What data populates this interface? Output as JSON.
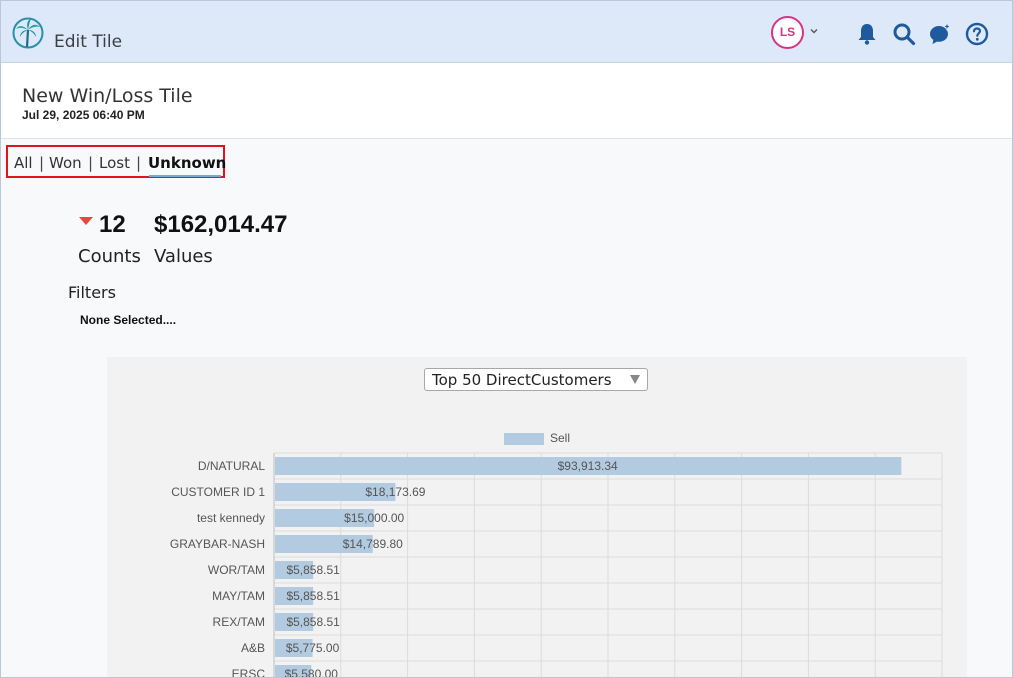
{
  "header": {
    "app_title": "Edit Tile",
    "avatar_initials": "LS",
    "icons": [
      "palm-tree-logo-icon",
      "chevron-down-icon",
      "bell-icon",
      "search-icon",
      "chat-sparkle-icon",
      "help-icon"
    ],
    "accent_color": "#d63384",
    "icon_color": "#1f5a9c"
  },
  "tile": {
    "name": "New Win/Loss Tile",
    "date": "Jul 29, 2025 06:40 PM"
  },
  "tabs": {
    "all": "All",
    "won": "Won",
    "lost": "Lost",
    "unknown": "Unknown",
    "separator": "|",
    "active": "Unknown",
    "highlight_color": "#e0141e"
  },
  "summary": {
    "count": "12",
    "count_label": "Counts",
    "value": "$162,014.47",
    "value_label": "Values",
    "trend": "down",
    "trend_color": "#e04b3c"
  },
  "filters": {
    "title": "Filters",
    "value": "None Selected...."
  },
  "chart_controls": {
    "select_value": "Top 50 DirectCustomers"
  },
  "chart_data": {
    "type": "bar",
    "orientation": "horizontal",
    "categories": [
      "D/NATURAL",
      "CUSTOMER ID 1",
      "test kennedy",
      "GRAYBAR-NASH",
      "WOR/TAM",
      "MAY/TAM",
      "REX/TAM",
      "A&B",
      "ERSC"
    ],
    "series": [
      {
        "name": "Sell",
        "values": [
          93913.34,
          18173.69,
          15000.0,
          14789.8,
          5858.51,
          5858.51,
          5858.51,
          5775.0,
          5580.0
        ],
        "labels": [
          "$93,913.34",
          "$18,173.69",
          "$15,000.00",
          "$14,789.80",
          "$5,858.51",
          "$5,858.51",
          "$5,858.51",
          "$5,775.00",
          "$5,580.00"
        ],
        "color": "#b3cbe0"
      }
    ],
    "xlim": [
      0,
      100000
    ],
    "grid": true,
    "legend": "top-center"
  }
}
